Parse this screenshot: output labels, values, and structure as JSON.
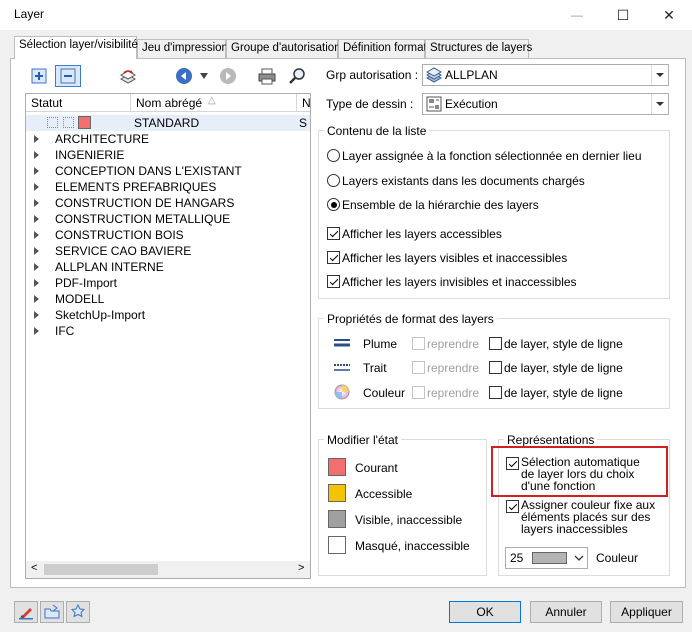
{
  "window": {
    "title": "Layer",
    "minimize_glyph": "—",
    "maximize_glyph": "☐",
    "close_glyph": "✕"
  },
  "tabs": [
    {
      "label": "Sélection layer/visibilité",
      "active": true
    },
    {
      "label": "Jeu d'impression"
    },
    {
      "label": "Groupe d'autorisation"
    },
    {
      "label": "Définition format"
    },
    {
      "label": "Structures de layers"
    }
  ],
  "toolbar": {
    "icons": [
      "expand-icon",
      "collapse-icon",
      "layer-swap-icon",
      "back-icon",
      "dropdown-icon",
      "forward-icon",
      "print-icon",
      "find-icon"
    ]
  },
  "tree": {
    "columns": [
      "Statut",
      "Nom abrégé",
      "N"
    ],
    "sort_glyph": "△",
    "selected_row": {
      "name": "STANDARD",
      "trail": "S",
      "status_color": "#f07070"
    },
    "items": [
      "ARCHITECTURE",
      "INGENIERIE",
      "CONCEPTION DANS L'EXISTANT",
      "ELEMENTS PREFABRIQUES",
      "CONSTRUCTION DE HANGARS",
      "CONSTRUCTION METALLIQUE",
      "CONSTRUCTION BOIS",
      "SERVICE CAO BAVIERE",
      "ALLPLAN INTERNE",
      "PDF-Import",
      "MODELL",
      "SketchUp-Import",
      "IFC"
    ],
    "scroll_left": "<",
    "scroll_right": ">"
  },
  "grp_autorisation": {
    "label": "Grp autorisation :",
    "value": "ALLPLAN"
  },
  "type_dessin": {
    "label": "Type de dessin :",
    "value": "Exécution"
  },
  "contenu": {
    "title": "Contenu de la liste",
    "radios": [
      {
        "label": "Layer assignée à la fonction sélectionnée en dernier lieu",
        "checked": false
      },
      {
        "label": "Layers existants dans les documents chargés",
        "checked": false
      },
      {
        "label": "Ensemble de la hiérarchie des layers",
        "checked": true
      }
    ],
    "checks": [
      {
        "label": "Afficher les layers accessibles",
        "checked": true
      },
      {
        "label": "Afficher les layers visibles et inaccessibles",
        "checked": true
      },
      {
        "label": "Afficher les layers invisibles et inaccessibles",
        "checked": true
      }
    ]
  },
  "proprietes": {
    "title": "Propriétés de format des layers",
    "rows": [
      {
        "label": "Plume",
        "reprendre": "reprendre",
        "option": "de layer, style de ligne",
        "icon": "pen-icon"
      },
      {
        "label": "Trait",
        "reprendre": "reprendre",
        "option": "de layer, style de ligne",
        "icon": "line-style-icon"
      },
      {
        "label": "Couleur",
        "reprendre": "reprendre",
        "option": "de layer, style de ligne",
        "icon": "color-wheel-icon"
      }
    ]
  },
  "modifier_etat": {
    "title": "Modifier l'état",
    "states": [
      {
        "label": "Courant",
        "color": "#f07070"
      },
      {
        "label": "Accessible",
        "color": "#f5c400"
      },
      {
        "label": "Visible, inaccessible",
        "color": "#a0a0a0"
      },
      {
        "label": "Masqué, inaccessible",
        "color": "#ffffff"
      }
    ]
  },
  "representations": {
    "title": "Représentations",
    "auto_select": {
      "label": "Sélection automatique de layer lors du choix d'une fonction",
      "checked": true
    },
    "fixed_color": {
      "label": "Assigner couleur fixe aux éléments placés sur des layers inaccessibles",
      "checked": true
    },
    "color_number": "25",
    "color_swatch": "#b4b4b4",
    "color_label": "Couleur"
  },
  "buttons": {
    "ok": "OK",
    "cancel": "Annuler",
    "apply": "Appliquer"
  },
  "bottom_icons": [
    "brush-icon",
    "folder-open-icon",
    "star-layer-icon"
  ]
}
